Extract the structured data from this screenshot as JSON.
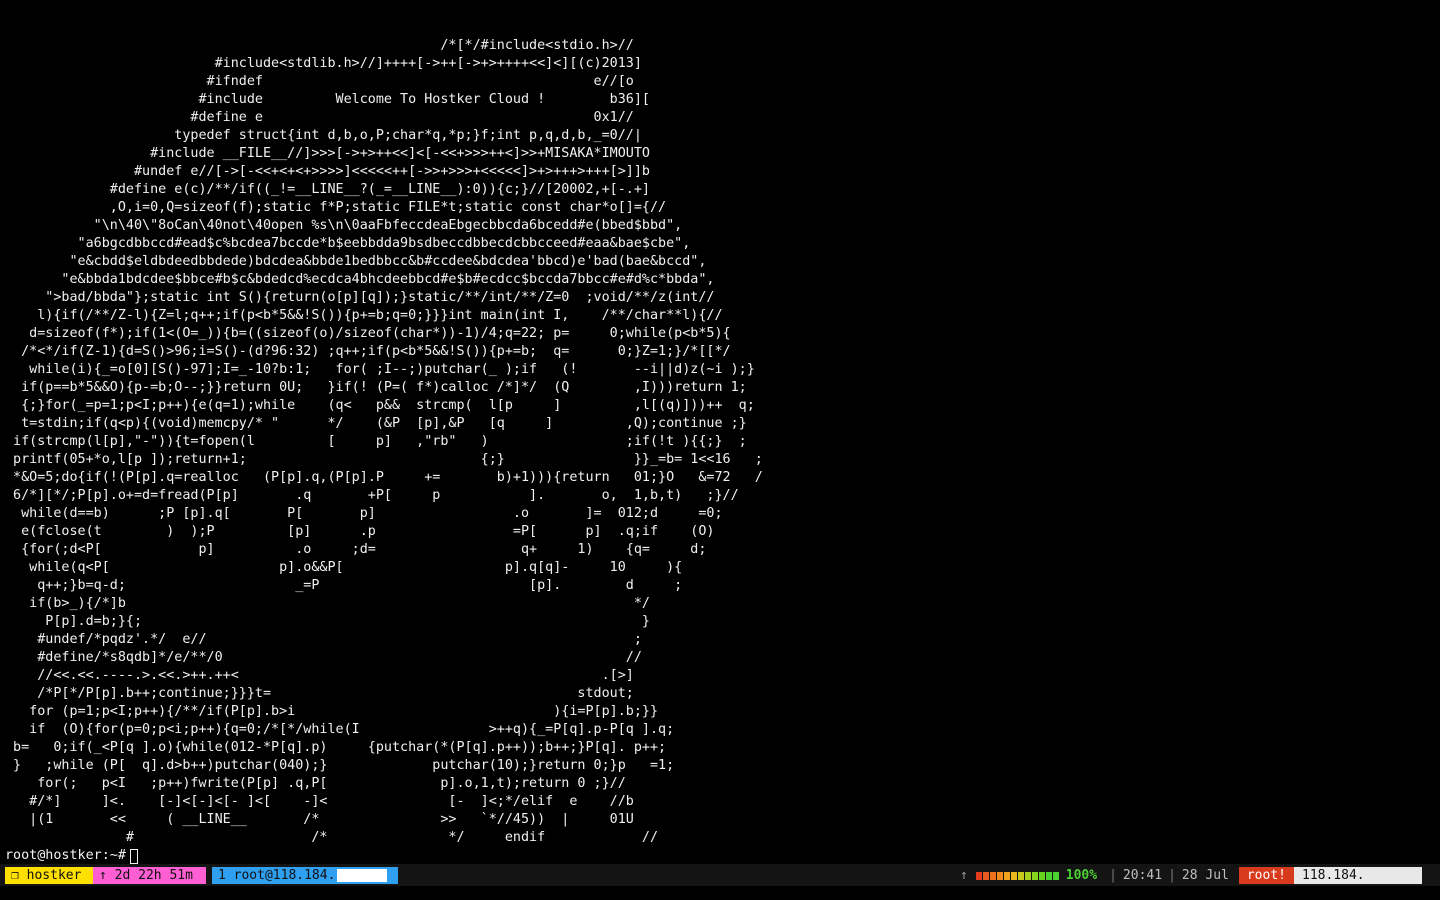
{
  "terminal": {
    "ascii_lines": [
      "                                                      /*[*/#include<stdio.h>//",
      "                          #include<stdlib.h>//]++++[->++[->+>++++<<]<][(c)2013]",
      "                         #ifndef                                         e//[o",
      "                        #include         Welcome To Hostker Cloud !        b36][",
      "                       #define e                                         0x1//",
      "                     typedef struct{int d,b,o,P;char*q,*p;}f;int p,q,d,b,_=0//|",
      "                  #include __FILE__//]>>>[->+>++<<]<[-<<+>>>++<]>>+MISAKA*IMOUTO",
      "                #undef e//[->[-<<+<+<+>>>>]<<<<<++[->>+>>>+<<<<<]>+>+++>+++[>]]b",
      "             #define e(c)/**/if((_!=__LINE__?(_=__LINE__):0)){c;}//[20002,+[-.+]",
      "             ,O,i=0,Q=sizeof(f);static f*P;static FILE*t;static const char*o[]={//",
      "           \"\\n\\40\\\"8oCan\\40not\\40open %s\\n\\0aaFbfeccdeaEbgecbbcda6bcedd#e(bbed$bbd\",",
      "         \"a6bgcdbbccd#ead$c%bcdea7bccde*b$eebbdda9bsdbeccdbbecdcbbcceed#eaa&bae$cbe\",",
      "        \"e&cbdd$eldbdeedbbdede)bdcdea&bbde1bedbbcc&b#ccdee&bdcdea'bbcd)e'bad(bae&bccd\",",
      "       \"e&bbda1bdcdee$bbce#b$c&bdedcd%ecdca4bhcdeebbcd#e$b#ecdcc$bccda7bbcc#e#d%c*bbda\",",
      "     \">bad/bbda\"};static int S(){return(o[p][q]);}static/**/int/**/Z=0  ;void/**/z(int//",
      "    l){if(/**/Z-l){Z=l;q++;if(p<b*5&&!S()){p+=b;q=0;}}}int main(int I,    /**/char**l){//",
      "   d=sizeof(f*);if(1<(O=_)){b=((sizeof(o)/sizeof(char*))-1)/4;q=22; p=     0;while(p<b*5){",
      "  /*<*/if(Z-1){d=S()>96;i=S()-(d?96:32) ;q++;if(p<b*5&&!S()){p+=b;  q=      0;}Z=1;}/*[[*/",
      "   while(i){_=o[0][S()-97];I=_-10?b:1;   for( ;I--;)putchar(_ );if   (!       --i||d)z(~i );}",
      "  if(p==b*5&&O){p-=b;O--;}}return 0U;   }if(! (P=( f*)calloc /*]*/  (Q        ,I)))return 1;",
      "  {;}for(_=p=1;p<I;p++){e(q=1);while    (q<   p&&  strcmp(  l[p     ]         ,l[(q)]))++  q;",
      "  t=stdin;if(q<p){(void)memcpy/* \"      */    (&P  [p],&P   [q     ]         ,Q);continue ;}",
      " if(strcmp(l[p],\"-\")){t=fopen(l         [     p]   ,\"rb\"   )                 ;if(!t ){{;}  ;",
      " printf(05+*o,l[p ]);return+1;                             {;}                }}_=b= 1<<16   ;",
      " *&O=5;do{if(!(P[p].q=realloc   (P[p].q,(P[p].P     +=       b)+1))){return   01;}O   &=72   /",
      " 6/*][*/;P[p].o+=d=fread(P[p]       .q       +P[     p           ].       o,  1,b,t)   ;}//",
      "  while(d==b)      ;P [p].q[       P[       p]                 .o       ]=  012;d     =0;",
      "  e(fclose(t        )  );P         [p]      .p                 =P[      p]  .q;if    (O)",
      "  {for(;d<P[            p]          .o     ;d=                  q+     1)    {q=     d;",
      "   while(q<P[                     p].o&&P[                    p].q[q]-     10     ){",
      "    q++;}b=q-d;                     _=P                          [p].        d     ;",
      "   if(b>_){/*]b                                                               */",
      "     P[p].d=b;}{;                                                              }",
      "    #undef/*pqdz'.*/  e//                                                     ;",
      "    #define/*s8qdb]*/e/**/0                                                  //",
      "    //<<.<<.----.>.<<.>++.++<                                             .[>]",
      "    /*P[*/P[p].b++;continue;}}}t=                                      stdout;",
      "   for (p=1;p<I;p++){/**/if(P[p].b>i                                ){i=P[p].b;}}",
      "   if  (O){for(p=0;p<i;p++){q=0;/*[*/while(I                >++q){_=P[q].p-P[q ].q;",
      " b=   0;if(_<P[q ].o){while(012-*P[q].p)     {putchar(*(P[q].p++));b++;}P[q]. p++;",
      " }   ;while (P[  q].d>b++)putchar(040);}             putchar(10);}return 0;}p   =1;",
      "    for(;   p<I   ;p++)fwrite(P[p] .q,P[              p].o,1,t);return 0 ;}//",
      "   #/*]     ]<.    [-]<[-]<[- ]<[    -]<               [-  ]<;*/elif  e    //b",
      "   |(1       <<     ( __LINE__       /*               >>   `*//45))  |     01U",
      "               #                      /*               */     endif            //"
    ],
    "prompt": "root@hostker:~#"
  },
  "statusbar": {
    "session_label": "❐ hostker",
    "uptime_label": "↑ 2d 22h 51m",
    "window_label": "1 root@118.184.",
    "upload_arrow": "↑",
    "battery_percent": "100%",
    "separator": "|",
    "clock": "20:41",
    "date": "28 Jul",
    "user_badge": "root!",
    "host_badge": "118.184.",
    "colors": {
      "session_bg": "#ffe000",
      "uptime_bg": "#ff5fd2",
      "window_bg": "#2f9ff0",
      "user_bg": "#d83a1e",
      "battery_green": "#4cd130",
      "battery_red": "#e53a1e",
      "battery_orange": "#f08a1e"
    },
    "battery_cells": [
      "#e53a1e",
      "#e85a1e",
      "#ec721e",
      "#f08a1e",
      "#f0a21e",
      "#e8b81e",
      "#c8c81e",
      "#a8d01e",
      "#88d41e",
      "#68d41e",
      "#4cd130",
      "#4cd130"
    ]
  }
}
